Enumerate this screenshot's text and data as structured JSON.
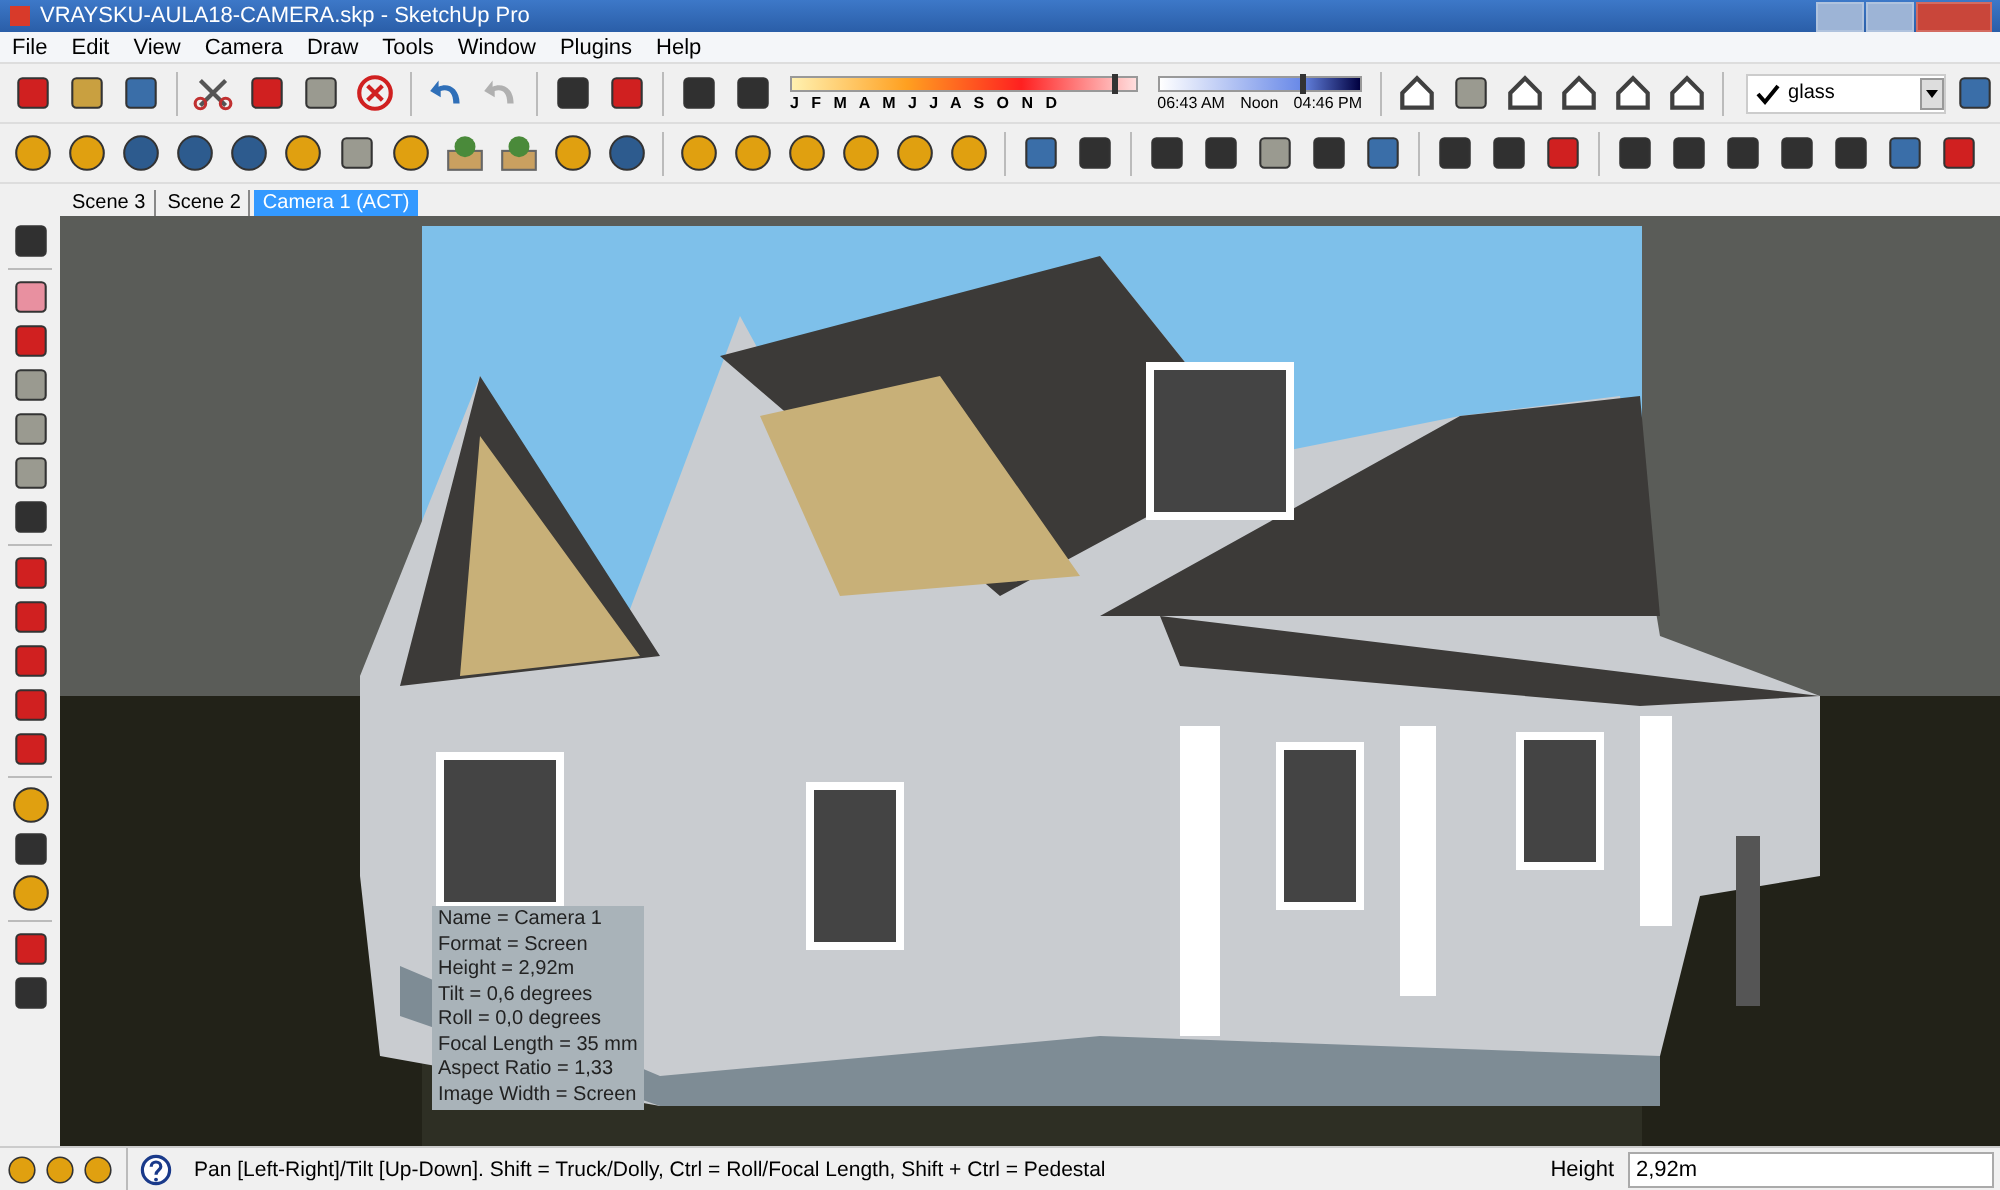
{
  "window": {
    "title": "VRAYSKU-AULA18-CAMERA.skp - SketchUp Pro"
  },
  "menu": [
    "File",
    "Edit",
    "View",
    "Camera",
    "Draw",
    "Tools",
    "Window",
    "Plugins",
    "Help"
  ],
  "shadow_settings": {
    "month_slider": {
      "level": 0.93
    },
    "time_slider": {
      "level": 0.7
    },
    "months": "J F M A M J J A S O N D",
    "time_start": "06:43 AM",
    "time_mid": "Noon",
    "time_end": "04:46 PM"
  },
  "layer": {
    "value": "glass"
  },
  "scene_tabs": [
    {
      "label": "Scene 3",
      "selected": false
    },
    {
      "label": "Scene 2",
      "selected": false
    },
    {
      "label": "Camera 1 (ACT)",
      "selected": true
    }
  ],
  "camera_info": [
    "Name = Camera 1",
    "Format = Screen",
    "Height = 2,92m",
    "Tilt = 0,6 degrees",
    "Roll = 0,0 degrees",
    "Focal Length = 35 mm",
    "Aspect Ratio = 1,33",
    "Image Width = Screen"
  ],
  "status_bar": {
    "message": "Pan [Left-Right]/Tilt [Up-Down]. Shift = Truck/Dolly, Ctrl = Roll/Focal Length, Shift + Ctrl = Pedestal",
    "measure_label": "Height",
    "measure_value": "2,92m"
  }
}
